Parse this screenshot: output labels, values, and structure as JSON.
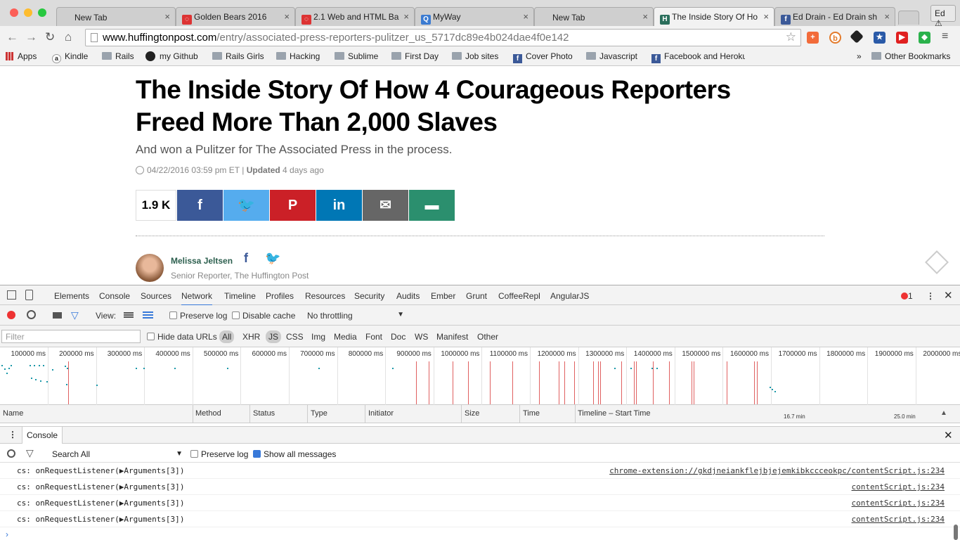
{
  "browser": {
    "tabs": [
      {
        "label": "New Tab",
        "fav_color": "#cfcfcf",
        "fav_glyph": ""
      },
      {
        "label": "Golden Bears 2016",
        "fav_color": "#d33",
        "fav_glyph": "◌"
      },
      {
        "label": "2.1 Web and HTML Ba",
        "fav_color": "#d33",
        "fav_glyph": "◌"
      },
      {
        "label": "MyWay",
        "fav_color": "#3b7bd1",
        "fav_glyph": "Q"
      },
      {
        "label": "New Tab",
        "fav_color": "#cfcfcf",
        "fav_glyph": ""
      },
      {
        "label": "The Inside Story Of Ho",
        "fav_color": "#2b6f5c",
        "fav_glyph": "H"
      },
      {
        "label": "Ed Drain - Ed Drain sh",
        "fav_color": "#3b5998",
        "fav_glyph": "f"
      }
    ],
    "profile_label": "Ed ⚠",
    "url_host": "www.huffingtonpost.com",
    "url_path": "/entry/associated-press-reporters-pulitzer_us_5717dc89e4b024dae4f0e142",
    "bookmarks": [
      {
        "label": "Apps",
        "icon": "apps-icon"
      },
      {
        "label": "Kindle",
        "icon": "amazon-icon"
      },
      {
        "label": "Rails",
        "icon": "folder-icon"
      },
      {
        "label": "my Github",
        "icon": "github-icon"
      },
      {
        "label": "Rails Girls",
        "icon": "folder-icon"
      },
      {
        "label": "Hacking",
        "icon": "folder-icon"
      },
      {
        "label": "Sublime",
        "icon": "folder-icon"
      },
      {
        "label": "First Day",
        "icon": "folder-icon"
      },
      {
        "label": "Job sites",
        "icon": "folder-icon"
      },
      {
        "label": "Cover Photo",
        "icon": "facebook-icon"
      },
      {
        "label": "Javascript",
        "icon": "folder-icon"
      },
      {
        "label": "Facebook and Heroku",
        "icon": "facebook-icon"
      }
    ],
    "bookmarks_overflow": "»",
    "other_bookmarks": "Other Bookmarks"
  },
  "article": {
    "headline": "The Inside Story Of How 4 Courageous Reporters Freed More Than 2,000 Slaves",
    "subhead": "And won a Pulitzer for The Associated Press in the process.",
    "date": "04/22/2016 03:59 pm ET",
    "separator": "|",
    "updated_label": "Updated",
    "updated_when": "4 days ago",
    "share_count": "1.9 K",
    "share_buttons": [
      {
        "name": "facebook",
        "glyph": "f",
        "color": "#3b5998"
      },
      {
        "name": "twitter",
        "glyph": "🐦",
        "color": "#55acee"
      },
      {
        "name": "pinterest",
        "glyph": "P",
        "color": "#cb2027"
      },
      {
        "name": "linkedin",
        "glyph": "in",
        "color": "#0077b5"
      },
      {
        "name": "email",
        "glyph": "✉",
        "color": "#666666"
      },
      {
        "name": "comment",
        "glyph": "▬",
        "color": "#2b8f6e"
      }
    ],
    "author_name": "Melissa Jeltsen",
    "author_title": "Senior Reporter, The Huffington Post"
  },
  "devtools": {
    "tabs": [
      "Elements",
      "Console",
      "Sources",
      "Network",
      "Timeline",
      "Profiles",
      "Resources",
      "Security",
      "Audits",
      "Ember",
      "Grunt",
      "CoffeeRepl",
      "AngularJS"
    ],
    "active_tab": "Network",
    "error_count": "1",
    "view_label": "View:",
    "preserve_log": "Preserve log",
    "disable_cache": "Disable cache",
    "throttling": "No throttling",
    "filter_placeholder": "Filter",
    "hide_data_urls": "Hide data URLs",
    "type_filters": [
      "All",
      "XHR",
      "JS",
      "CSS",
      "Img",
      "Media",
      "Font",
      "Doc",
      "WS",
      "Manifest",
      "Other"
    ],
    "ticks": [
      "100000 ms",
      "200000 ms",
      "300000 ms",
      "400000 ms",
      "500000 ms",
      "600000 ms",
      "700000 ms",
      "800000 ms",
      "900000 ms",
      "1000000 ms",
      "1100000 ms",
      "1200000 ms",
      "1300000 ms",
      "1400000 ms",
      "1500000 ms",
      "1600000 ms",
      "1700000 ms",
      "1800000 ms",
      "1900000 ms",
      "2000000 ms"
    ],
    "columns": [
      "Name",
      "Method",
      "Status",
      "Type",
      "Initiator",
      "Size",
      "Time",
      "Timeline – Start Time"
    ],
    "timeline_marks": [
      "16.7 min",
      "25.0 min"
    ],
    "drawer_tab": "Console",
    "console_context": "Search All",
    "console_preserve_log": "Preserve log",
    "show_all_messages": "Show all messages",
    "log_lines": [
      {
        "msg": "cs: onRequestListener(",
        "args": "Arguments[3]",
        "end": ")",
        "src": "chrome-extension://gkdjneiankflejbjejemkibkccceokpc/contentScript.js:234"
      },
      {
        "msg": "cs: onRequestListener(",
        "args": "Arguments[3]",
        "end": ")",
        "src": "contentScript.js:234"
      },
      {
        "msg": "cs: onRequestListener(",
        "args": "Arguments[3]",
        "end": ")",
        "src": "contentScript.js:234"
      },
      {
        "msg": "cs: onRequestListener(",
        "args": "Arguments[3]",
        "end": ")",
        "src": "contentScript.js:234"
      }
    ],
    "prompt": "›"
  }
}
